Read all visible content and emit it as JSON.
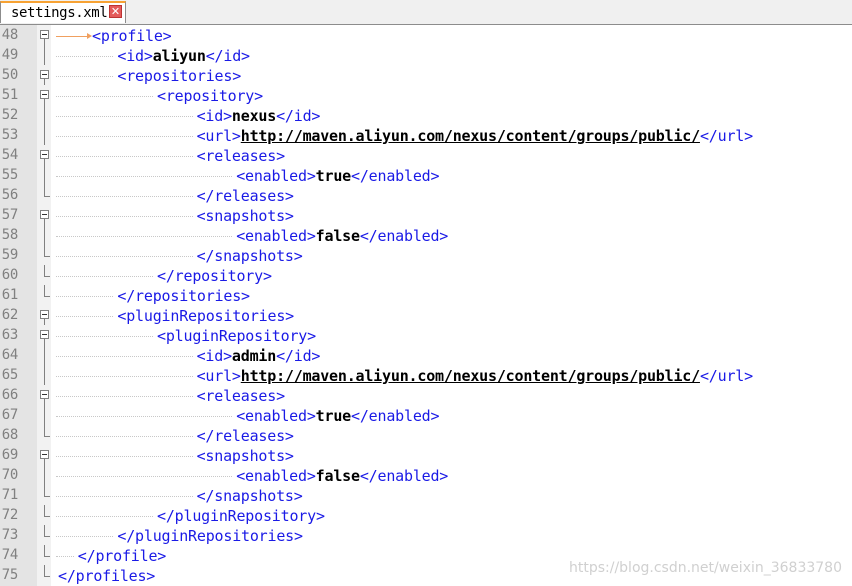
{
  "tab": {
    "filename": "settings.xml",
    "close_glyph": "✕"
  },
  "lines": [
    {
      "n": "48",
      "indent": 2,
      "parts": [
        [
          "tag",
          "<profile>"
        ]
      ]
    },
    {
      "n": "49",
      "indent": 4,
      "parts": [
        [
          "tag",
          "<id>"
        ],
        [
          "txt",
          "aliyun"
        ],
        [
          "tag",
          "</id>"
        ]
      ]
    },
    {
      "n": "50",
      "indent": 4,
      "parts": [
        [
          "tag",
          "<repositories>"
        ]
      ]
    },
    {
      "n": "51",
      "indent": 6,
      "parts": [
        [
          "tag",
          "<repository>"
        ]
      ]
    },
    {
      "n": "52",
      "indent": 8,
      "parts": [
        [
          "tag",
          "<id>"
        ],
        [
          "txt",
          "nexus"
        ],
        [
          "tag",
          "</id>"
        ]
      ]
    },
    {
      "n": "53",
      "indent": 8,
      "parts": [
        [
          "tag",
          "<url>"
        ],
        [
          "url",
          "http://maven.aliyun.com/nexus/content/groups/public/"
        ],
        [
          "tag",
          "</url>"
        ]
      ]
    },
    {
      "n": "54",
      "indent": 8,
      "parts": [
        [
          "tag",
          "<releases>"
        ]
      ]
    },
    {
      "n": "55",
      "indent": 10,
      "parts": [
        [
          "tag",
          "<enabled>"
        ],
        [
          "txt",
          "true"
        ],
        [
          "tag",
          "</enabled>"
        ]
      ]
    },
    {
      "n": "56",
      "indent": 8,
      "parts": [
        [
          "tag",
          "</releases>"
        ]
      ]
    },
    {
      "n": "57",
      "indent": 8,
      "parts": [
        [
          "tag",
          "<snapshots>"
        ]
      ]
    },
    {
      "n": "58",
      "indent": 10,
      "parts": [
        [
          "tag",
          "<enabled>"
        ],
        [
          "txt",
          "false"
        ],
        [
          "tag",
          "</enabled>"
        ]
      ]
    },
    {
      "n": "59",
      "indent": 8,
      "parts": [
        [
          "tag",
          "</snapshots>"
        ]
      ]
    },
    {
      "n": "60",
      "indent": 6,
      "parts": [
        [
          "tag",
          "</repository>"
        ]
      ]
    },
    {
      "n": "61",
      "indent": 4,
      "parts": [
        [
          "tag",
          "</repositories>"
        ]
      ]
    },
    {
      "n": "62",
      "indent": 4,
      "parts": [
        [
          "tag",
          "<pluginRepositories>"
        ]
      ]
    },
    {
      "n": "63",
      "indent": 6,
      "parts": [
        [
          "tag",
          "<pluginRepository>"
        ]
      ]
    },
    {
      "n": "64",
      "indent": 8,
      "parts": [
        [
          "tag",
          "<id>"
        ],
        [
          "txt",
          "admin"
        ],
        [
          "tag",
          "</id>"
        ]
      ]
    },
    {
      "n": "65",
      "indent": 8,
      "parts": [
        [
          "tag",
          "<url>"
        ],
        [
          "url",
          "http://maven.aliyun.com/nexus/content/groups/public/"
        ],
        [
          "tag",
          "</url>"
        ]
      ]
    },
    {
      "n": "66",
      "indent": 8,
      "parts": [
        [
          "tag",
          "<releases>"
        ]
      ]
    },
    {
      "n": "67",
      "indent": 10,
      "parts": [
        [
          "tag",
          "<enabled>"
        ],
        [
          "txt",
          "true"
        ],
        [
          "tag",
          "</enabled>"
        ]
      ]
    },
    {
      "n": "68",
      "indent": 8,
      "parts": [
        [
          "tag",
          "</releases>"
        ]
      ]
    },
    {
      "n": "69",
      "indent": 8,
      "parts": [
        [
          "tag",
          "<snapshots>"
        ]
      ]
    },
    {
      "n": "70",
      "indent": 10,
      "parts": [
        [
          "tag",
          "<enabled>"
        ],
        [
          "txt",
          "false"
        ],
        [
          "tag",
          "</enabled>"
        ]
      ]
    },
    {
      "n": "71",
      "indent": 8,
      "parts": [
        [
          "tag",
          "</snapshots>"
        ]
      ]
    },
    {
      "n": "72",
      "indent": 6,
      "parts": [
        [
          "tag",
          "</pluginRepository>"
        ]
      ]
    },
    {
      "n": "73",
      "indent": 4,
      "parts": [
        [
          "tag",
          "</pluginRepositories>"
        ]
      ]
    },
    {
      "n": "74",
      "indent": 2,
      "parts": [
        [
          "tag",
          "</profile>"
        ]
      ]
    },
    {
      "n": "75",
      "indent": 1,
      "parts": [
        [
          "tag",
          "</profiles>"
        ]
      ]
    }
  ],
  "folds": {
    "open": [
      "48",
      "50",
      "51",
      "54",
      "57",
      "62",
      "63",
      "66",
      "69"
    ],
    "close": [
      "56",
      "59",
      "60",
      "61",
      "68",
      "71",
      "72",
      "73",
      "74",
      "75"
    ]
  },
  "watermark": "https://blog.csdn.net/weixin_36833780"
}
